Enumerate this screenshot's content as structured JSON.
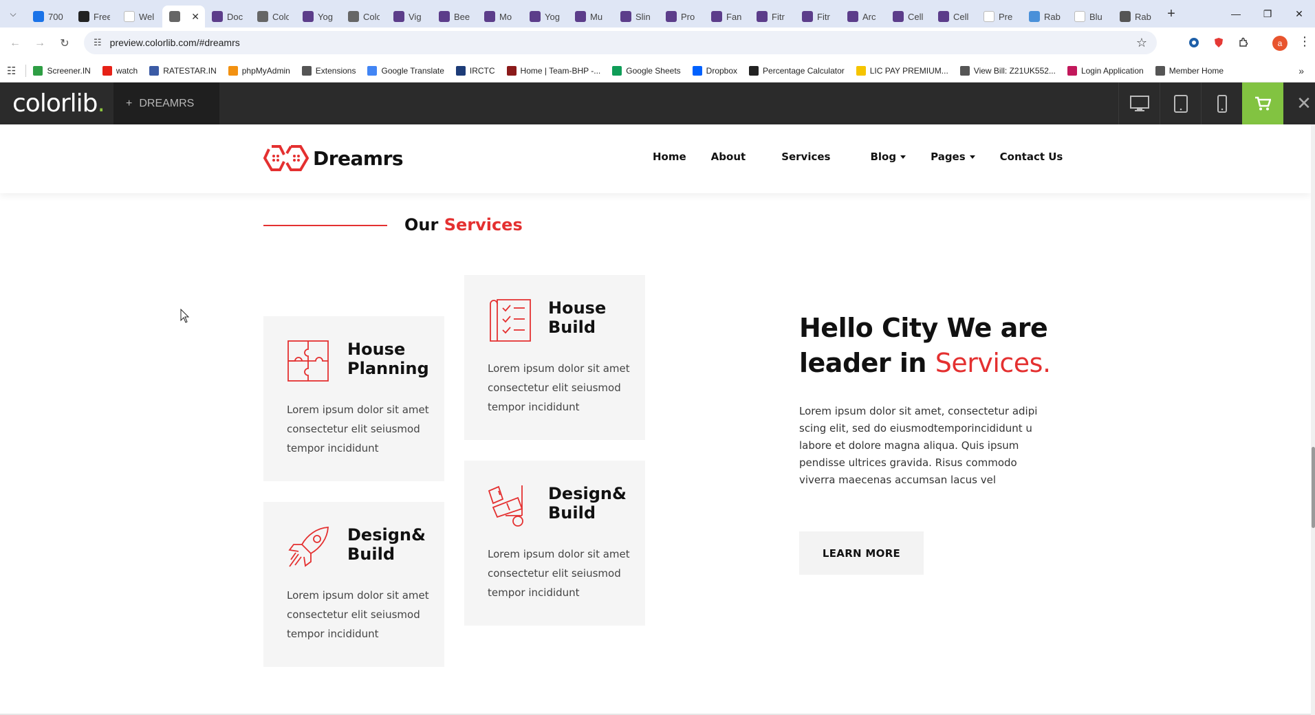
{
  "browser": {
    "tabs": [
      {
        "label": "700",
        "color": "#1a73e8"
      },
      {
        "label": "Free",
        "color": "#222222"
      },
      {
        "label": "Wel",
        "color": "#ffffff"
      },
      {
        "label": "",
        "color": "#666666",
        "active": true
      },
      {
        "label": "Doc",
        "color": "#5c3d8a"
      },
      {
        "label": "Colo",
        "color": "#666666"
      },
      {
        "label": "Yog",
        "color": "#5c3d8a"
      },
      {
        "label": "Colo",
        "color": "#666666"
      },
      {
        "label": "Vig",
        "color": "#5c3d8a"
      },
      {
        "label": "Bee",
        "color": "#5c3d8a"
      },
      {
        "label": "Mo",
        "color": "#5c3d8a"
      },
      {
        "label": "Yog",
        "color": "#5c3d8a"
      },
      {
        "label": "Mu",
        "color": "#5c3d8a"
      },
      {
        "label": "Slin",
        "color": "#5c3d8a"
      },
      {
        "label": "Pro",
        "color": "#5c3d8a"
      },
      {
        "label": "Fan",
        "color": "#5c3d8a"
      },
      {
        "label": "Fitr",
        "color": "#5c3d8a"
      },
      {
        "label": "Fitr",
        "color": "#5c3d8a"
      },
      {
        "label": "Arc",
        "color": "#5c3d8a"
      },
      {
        "label": "Cell",
        "color": "#5c3d8a"
      },
      {
        "label": "Cell",
        "color": "#5c3d8a"
      },
      {
        "label": "Pre",
        "color": "#ffffff"
      },
      {
        "label": "Rab",
        "color": "#4a90d9"
      },
      {
        "label": "Blu",
        "color": "#ffffff"
      },
      {
        "label": "Rab",
        "color": "#555555"
      }
    ],
    "url": "preview.colorlib.com/#dreamrs",
    "profile_initial": "a",
    "bookmarks": [
      {
        "label": "Screener.IN",
        "color": "#2e9e44"
      },
      {
        "label": "watch",
        "color": "#e62117"
      },
      {
        "label": "RATESTAR.IN",
        "color": "#3b5ba5"
      },
      {
        "label": "phpMyAdmin",
        "color": "#f29111"
      },
      {
        "label": "Extensions",
        "color": "#555555"
      },
      {
        "label": "Google Translate",
        "color": "#4285f4"
      },
      {
        "label": "IRCTC",
        "color": "#1d3c78"
      },
      {
        "label": "Home | Team-BHP -...",
        "color": "#8b1a1a"
      },
      {
        "label": "Google Sheets",
        "color": "#0f9d58"
      },
      {
        "label": "Dropbox",
        "color": "#0061fe"
      },
      {
        "label": "Percentage Calculator",
        "color": "#222222"
      },
      {
        "label": "LIC PAY PREMIUM...",
        "color": "#f5c400"
      },
      {
        "label": "View Bill: Z21UK552...",
        "color": "#555555"
      },
      {
        "label": "Login Application",
        "color": "#c2185b"
      },
      {
        "label": "Member Home",
        "color": "#555555"
      }
    ]
  },
  "colorlib": {
    "logo": "colorlib",
    "logo_dot": ".",
    "project_plus": "+",
    "project": "DREAMRS",
    "accent": "#82c341"
  },
  "site": {
    "brand": "Dreamrs",
    "accent": "#e43030",
    "nav": [
      {
        "label": "Home",
        "dropdown": false
      },
      {
        "label": "About",
        "dropdown": false
      },
      {
        "label": "Services",
        "dropdown": false
      },
      {
        "label": "Blog",
        "dropdown": true
      },
      {
        "label": "Pages",
        "dropdown": true
      },
      {
        "label": "Contact Us",
        "dropdown": false
      }
    ],
    "section_title_a": "Our",
    "section_title_b": "Services",
    "cards": [
      {
        "icon": "puzzle-icon",
        "title": "House Planning",
        "desc": "Lorem ipsum dolor sit amet consectetur elit seiusmod tempor incididunt"
      },
      {
        "icon": "checklist-icon",
        "title": "House Build",
        "desc": "Lorem ipsum dolor sit amet consectetur elit seiusmod tempor incididunt"
      },
      {
        "icon": "rocket-icon",
        "title": "Design& Build",
        "desc": "Lorem ipsum dolor sit amet consectetur elit seiusmod tempor incididunt"
      },
      {
        "icon": "trolley-icon",
        "title": "Design& Build",
        "desc": "Lorem ipsum dolor sit amet consectetur elit seiusmod tempor incididunt"
      }
    ],
    "hello_a": "Hello City We are leader in ",
    "hello_b": "Services.",
    "about": "Lorem ipsum dolor sit amet, consectetur adipi scing elit, sed do eiusmodtemporincididunt u labore et dolore magna aliqua. Quis ipsum pendisse ultrices gravida. Risus commodo viverra maecenas accumsan lacus vel",
    "cta": "LEARN MORE"
  }
}
